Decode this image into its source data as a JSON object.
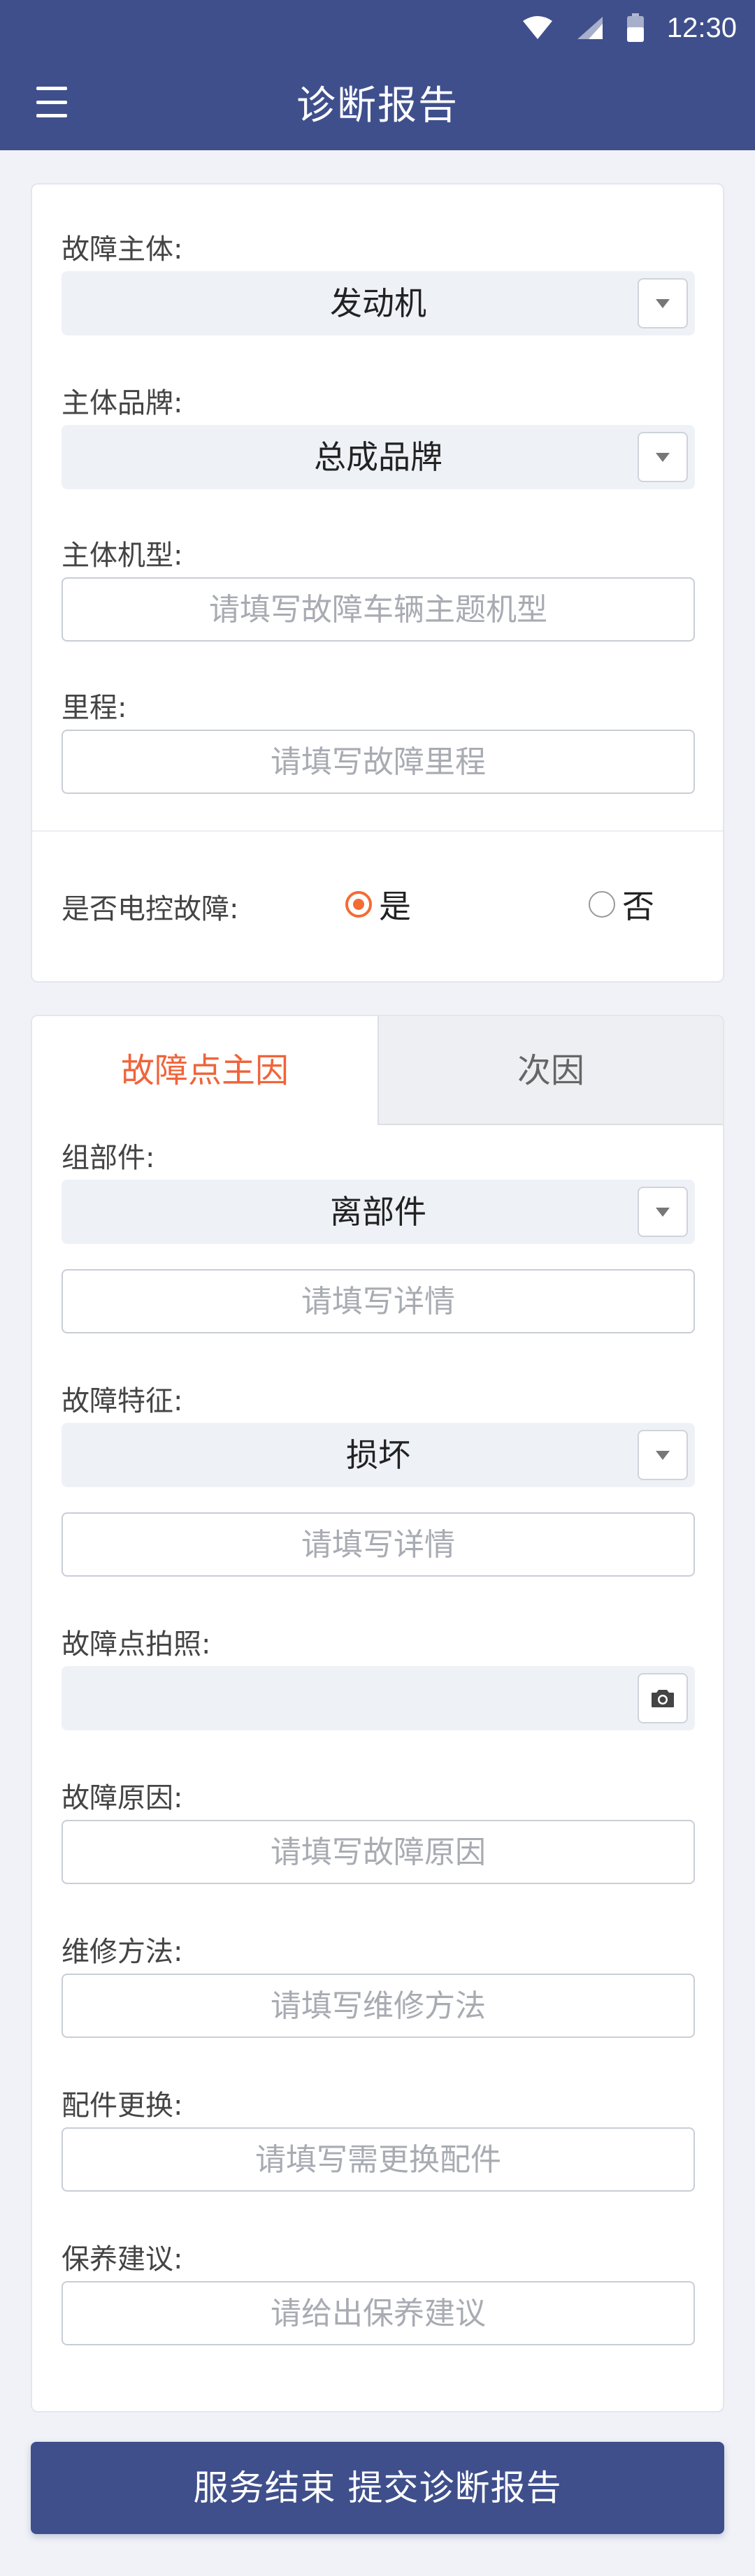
{
  "status_bar": {
    "time": "12:30"
  },
  "header": {
    "title": "诊断报告"
  },
  "section1": {
    "fault_subject_label": "故障主体:",
    "fault_subject_value": "发动机",
    "brand_label": "主体品牌:",
    "brand_value": "总成品牌",
    "model_label": "主体机型:",
    "model_placeholder": "请填写故障车辆主题机型",
    "mileage_label": "里程:",
    "mileage_placeholder": "请填写故障里程",
    "ecu_fault_label": "是否电控故障:",
    "ecu_yes": "是",
    "ecu_no": "否",
    "ecu_selected": "是"
  },
  "section2": {
    "tabs": {
      "primary": "故障点主因",
      "secondary": "次因"
    },
    "component_label": "组部件:",
    "component_value": "离部件",
    "component_detail_placeholder": "请填写详情",
    "feature_label": "故障特征:",
    "feature_value": "损坏",
    "feature_detail_placeholder": "请填写详情",
    "photo_label": "故障点拍照:",
    "cause_label": "故障原因:",
    "cause_placeholder": "请填写故障原因",
    "repair_label": "维修方法:",
    "repair_placeholder": "请填写维修方法",
    "parts_label": "配件更换:",
    "parts_placeholder": "请填写需更换配件",
    "maintenance_label": "保养建议:",
    "maintenance_placeholder": "请给出保养建议"
  },
  "submit_button": "服务结束 提交诊断报告",
  "colors": {
    "primary": "#3f4f8c",
    "accent": "#f36c34",
    "background": "#f0f2f7"
  }
}
